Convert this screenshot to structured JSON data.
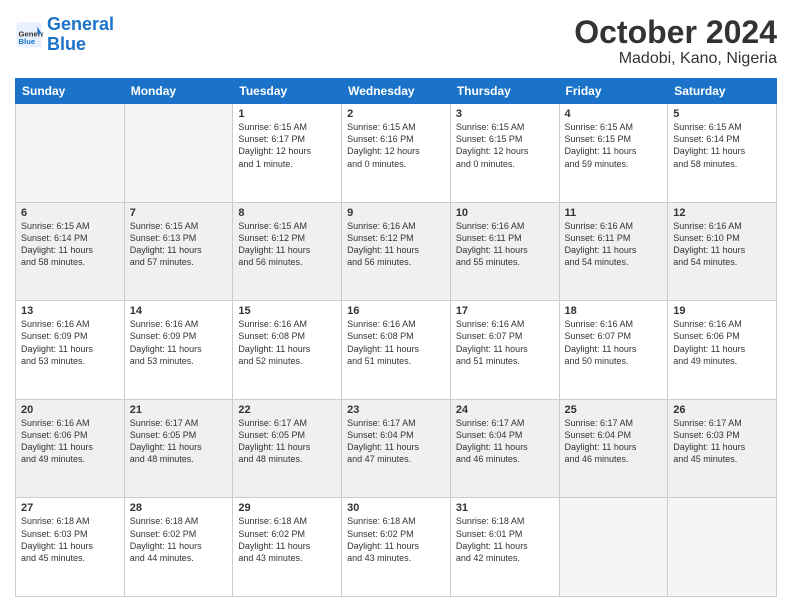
{
  "logo": {
    "line1": "General",
    "line2": "Blue"
  },
  "header": {
    "month": "October 2024",
    "location": "Madobi, Kano, Nigeria"
  },
  "weekdays": [
    "Sunday",
    "Monday",
    "Tuesday",
    "Wednesday",
    "Thursday",
    "Friday",
    "Saturday"
  ],
  "weeks": [
    [
      {
        "day": "",
        "info": ""
      },
      {
        "day": "",
        "info": ""
      },
      {
        "day": "1",
        "info": "Sunrise: 6:15 AM\nSunset: 6:17 PM\nDaylight: 12 hours\nand 1 minute."
      },
      {
        "day": "2",
        "info": "Sunrise: 6:15 AM\nSunset: 6:16 PM\nDaylight: 12 hours\nand 0 minutes."
      },
      {
        "day": "3",
        "info": "Sunrise: 6:15 AM\nSunset: 6:15 PM\nDaylight: 12 hours\nand 0 minutes."
      },
      {
        "day": "4",
        "info": "Sunrise: 6:15 AM\nSunset: 6:15 PM\nDaylight: 11 hours\nand 59 minutes."
      },
      {
        "day": "5",
        "info": "Sunrise: 6:15 AM\nSunset: 6:14 PM\nDaylight: 11 hours\nand 58 minutes."
      }
    ],
    [
      {
        "day": "6",
        "info": "Sunrise: 6:15 AM\nSunset: 6:14 PM\nDaylight: 11 hours\nand 58 minutes."
      },
      {
        "day": "7",
        "info": "Sunrise: 6:15 AM\nSunset: 6:13 PM\nDaylight: 11 hours\nand 57 minutes."
      },
      {
        "day": "8",
        "info": "Sunrise: 6:15 AM\nSunset: 6:12 PM\nDaylight: 11 hours\nand 56 minutes."
      },
      {
        "day": "9",
        "info": "Sunrise: 6:16 AM\nSunset: 6:12 PM\nDaylight: 11 hours\nand 56 minutes."
      },
      {
        "day": "10",
        "info": "Sunrise: 6:16 AM\nSunset: 6:11 PM\nDaylight: 11 hours\nand 55 minutes."
      },
      {
        "day": "11",
        "info": "Sunrise: 6:16 AM\nSunset: 6:11 PM\nDaylight: 11 hours\nand 54 minutes."
      },
      {
        "day": "12",
        "info": "Sunrise: 6:16 AM\nSunset: 6:10 PM\nDaylight: 11 hours\nand 54 minutes."
      }
    ],
    [
      {
        "day": "13",
        "info": "Sunrise: 6:16 AM\nSunset: 6:09 PM\nDaylight: 11 hours\nand 53 minutes."
      },
      {
        "day": "14",
        "info": "Sunrise: 6:16 AM\nSunset: 6:09 PM\nDaylight: 11 hours\nand 53 minutes."
      },
      {
        "day": "15",
        "info": "Sunrise: 6:16 AM\nSunset: 6:08 PM\nDaylight: 11 hours\nand 52 minutes."
      },
      {
        "day": "16",
        "info": "Sunrise: 6:16 AM\nSunset: 6:08 PM\nDaylight: 11 hours\nand 51 minutes."
      },
      {
        "day": "17",
        "info": "Sunrise: 6:16 AM\nSunset: 6:07 PM\nDaylight: 11 hours\nand 51 minutes."
      },
      {
        "day": "18",
        "info": "Sunrise: 6:16 AM\nSunset: 6:07 PM\nDaylight: 11 hours\nand 50 minutes."
      },
      {
        "day": "19",
        "info": "Sunrise: 6:16 AM\nSunset: 6:06 PM\nDaylight: 11 hours\nand 49 minutes."
      }
    ],
    [
      {
        "day": "20",
        "info": "Sunrise: 6:16 AM\nSunset: 6:06 PM\nDaylight: 11 hours\nand 49 minutes."
      },
      {
        "day": "21",
        "info": "Sunrise: 6:17 AM\nSunset: 6:05 PM\nDaylight: 11 hours\nand 48 minutes."
      },
      {
        "day": "22",
        "info": "Sunrise: 6:17 AM\nSunset: 6:05 PM\nDaylight: 11 hours\nand 48 minutes."
      },
      {
        "day": "23",
        "info": "Sunrise: 6:17 AM\nSunset: 6:04 PM\nDaylight: 11 hours\nand 47 minutes."
      },
      {
        "day": "24",
        "info": "Sunrise: 6:17 AM\nSunset: 6:04 PM\nDaylight: 11 hours\nand 46 minutes."
      },
      {
        "day": "25",
        "info": "Sunrise: 6:17 AM\nSunset: 6:04 PM\nDaylight: 11 hours\nand 46 minutes."
      },
      {
        "day": "26",
        "info": "Sunrise: 6:17 AM\nSunset: 6:03 PM\nDaylight: 11 hours\nand 45 minutes."
      }
    ],
    [
      {
        "day": "27",
        "info": "Sunrise: 6:18 AM\nSunset: 6:03 PM\nDaylight: 11 hours\nand 45 minutes."
      },
      {
        "day": "28",
        "info": "Sunrise: 6:18 AM\nSunset: 6:02 PM\nDaylight: 11 hours\nand 44 minutes."
      },
      {
        "day": "29",
        "info": "Sunrise: 6:18 AM\nSunset: 6:02 PM\nDaylight: 11 hours\nand 43 minutes."
      },
      {
        "day": "30",
        "info": "Sunrise: 6:18 AM\nSunset: 6:02 PM\nDaylight: 11 hours\nand 43 minutes."
      },
      {
        "day": "31",
        "info": "Sunrise: 6:18 AM\nSunset: 6:01 PM\nDaylight: 11 hours\nand 42 minutes."
      },
      {
        "day": "",
        "info": ""
      },
      {
        "day": "",
        "info": ""
      }
    ]
  ]
}
